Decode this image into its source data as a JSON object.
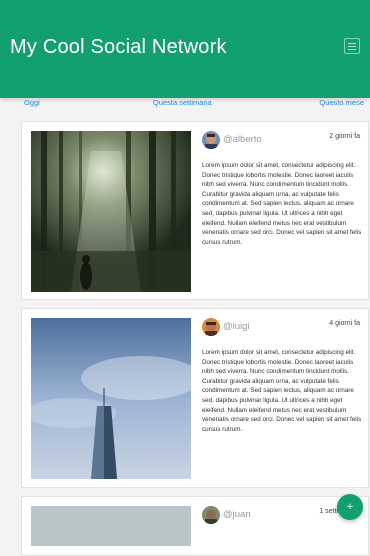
{
  "header": {
    "title": "My Cool Social Network",
    "menu_icon": "hamburger-icon"
  },
  "tabs": [
    {
      "label": "Oggi"
    },
    {
      "label": "Questa settimana"
    },
    {
      "label": "Questo mese"
    }
  ],
  "posts": [
    {
      "username": "@alberto",
      "time": "2 giorni fa",
      "photo": "forest-photo",
      "text": "Lorem ipsum dolor sit amet, consectetur adipiscing elit. Donec tristique lobortis molestie. Donec laoreet iaculis nibh sed viverra. Nunc condimentum tincidunt mollis. Curabitur gravida aliquam urna, ac vulputate felis condimentum at. Sed sapien lectus, aliquam ac ornare sed, dapibus pulvinar ligula. Ut ultrices a nibh eget eleifend. Nullam eleifend metus nec erat vestibulum venenatis ornare sed orci. Donec vel sapien sit amet felis cursus rutrum."
    },
    {
      "username": "@luigi",
      "time": "4 giorni fa",
      "photo": "skyscraper-photo",
      "text": "Lorem ipsum dolor sit amet, consectetur adipiscing elit. Donec tristique lobortis molestie. Donec laoreet iaculis nibh sed viverra. Nunc condimentum tincidunt mollis. Curabitur gravida aliquam urna, ac vulputate felis condimentum at. Sed sapien lectus, aliquam ac ornare sed, dapibus pulvinar ligula. Ut ultrices a nibh eget eleifend. Nullam eleifend metus nec erat vestibulum venenatis ornare sed orci. Donec vel sapien sit amet felis cursus rutrum."
    },
    {
      "username": "@juan",
      "time": "1 setti"
    }
  ],
  "fab": {
    "label": "+",
    "icon": "plus-icon"
  },
  "colors": {
    "primary": "#12a071",
    "link": "#1e88e5"
  }
}
